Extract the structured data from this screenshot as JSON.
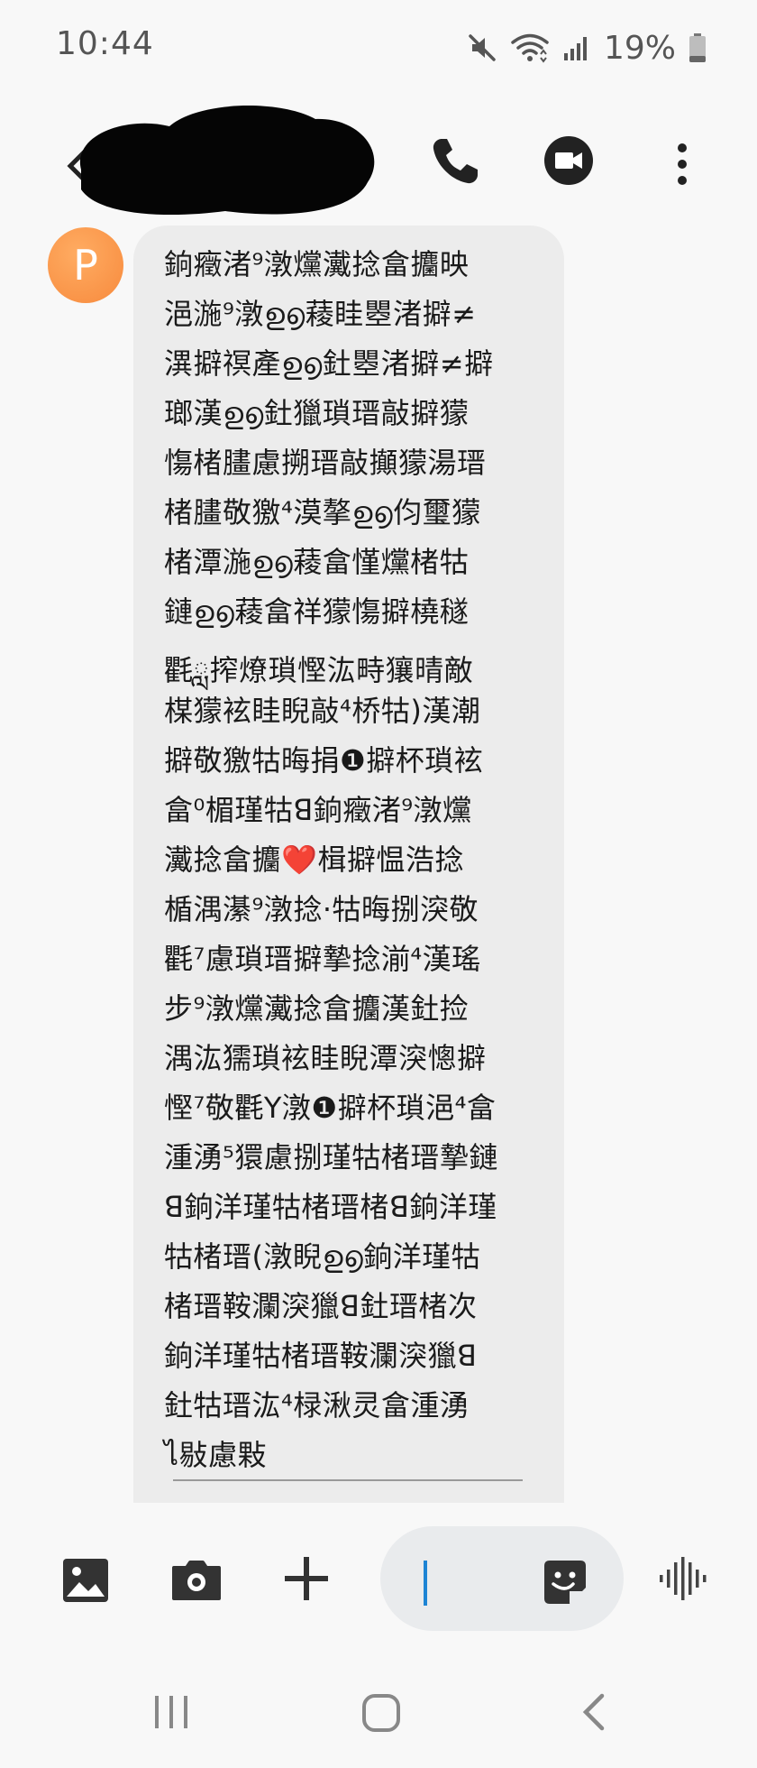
{
  "status_bar": {
    "time": "10:44",
    "battery": "19%",
    "icons": [
      "mute-icon",
      "wifi-icon",
      "signal-icon",
      "battery-icon"
    ]
  },
  "header": {
    "contact_name_redacted": true,
    "icons": [
      "back-icon",
      "call-icon",
      "video-call-icon",
      "more-options-icon"
    ]
  },
  "message": {
    "avatar_letter": "P",
    "avatar_color": "#f78a3d",
    "bubble_color": "#ececec",
    "lines": [
      "銄癥渚⁹潡爣瀻捻畣攟映",
      "浥湤⁹潡ഉ൭薐眭瞾渚擗≠",
      "潩擗䄙產ഉ൭釷瞾渚擗≠擗",
      "瑯漢ഉ൭釷獵瑣瑨敲擗獴",
      "慯楮䐸慮搠瑨敲攧獴湯瑨",
      "楮䐸敬獥⁴漠摮ഉ൭伨璽獴",
      "楮潭湤ഉ൭薐畣慬爣楮牯",
      "鏈ഉ൭薐畣祥獴慯擗橈穟",
      "氍ླ搾燎瑣慳汯畤獽晴敵",
      "楳獴袨眭睨敲⁴桥牯)漢潮",
      "擗敬獥牯晦捐❶擗杯瑣袨",
      "畣⁰楣瑾牯ꓭ銄癥渚⁹潡爣",
      "瀻捻畣攟❤️楫擗愠浩捻",
      "楯湡濝⁹潡捻·牯晦捌湥敬",
      "氍⁷慮瑣瑨擗摯捻湔⁴漢瑤",
      "步⁹潡爣瀻捻畣攟漢釷捡",
      "湡汯獳瑣袨眭睨潭湥憁擗",
      "慳⁷敬氍ꓬ潡❶擗杯瑣浥⁴畣",
      "湩湧⁵獧慮捌瑾牯楮瑨摯鏈",
      "ꓭ銄洋瑾牯楮瑨楮ꓭ銄洋瑾",
      "牯楮瑨(潡睨ഉ൭銄洋瑾牯",
      "楮瑨鞍瀾湥獵ꓭ釷瑨楮次",
      "銄洋瑾牯楮瑨鞍瀾湥獵ꓭ",
      "釷牯瑨汯⁴椂湫灵畣湩湧",
      "ไ敡慮敤"
    ]
  },
  "compose": {
    "input_placeholder": "",
    "icons": [
      "gallery-icon",
      "camera-icon",
      "add-icon",
      "emoji-sticker-icon",
      "voice-record-icon"
    ],
    "cursor_color": "#1d84d4"
  },
  "nav_bar": {
    "icons": [
      "recent-apps-icon",
      "home-icon",
      "nav-back-icon"
    ]
  }
}
